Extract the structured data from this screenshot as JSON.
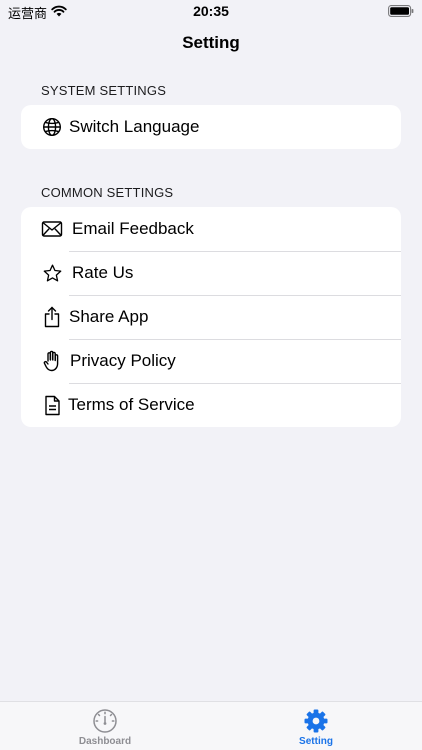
{
  "status_bar": {
    "carrier": "运营商",
    "time": "20:35"
  },
  "nav": {
    "title": "Setting"
  },
  "sections": [
    {
      "header": "SYSTEM SETTINGS",
      "items": [
        {
          "label": "Switch Language",
          "icon": "globe-icon"
        }
      ]
    },
    {
      "header": "COMMON SETTINGS",
      "items": [
        {
          "label": "Email Feedback",
          "icon": "envelope-icon"
        },
        {
          "label": "Rate Us",
          "icon": "star-icon"
        },
        {
          "label": "Share App",
          "icon": "share-icon"
        },
        {
          "label": "Privacy Policy",
          "icon": "hand-icon"
        },
        {
          "label": "Terms of Service",
          "icon": "document-icon"
        }
      ]
    }
  ],
  "tab_bar": {
    "tabs": [
      {
        "label": "Dashboard",
        "icon": "gauge-icon",
        "selected": false
      },
      {
        "label": "Setting",
        "icon": "gear-icon",
        "selected": true
      }
    ]
  },
  "colors": {
    "background": "#f2f2f7",
    "accent": "#1a73e8",
    "inactive_tab": "#8e8e93"
  }
}
